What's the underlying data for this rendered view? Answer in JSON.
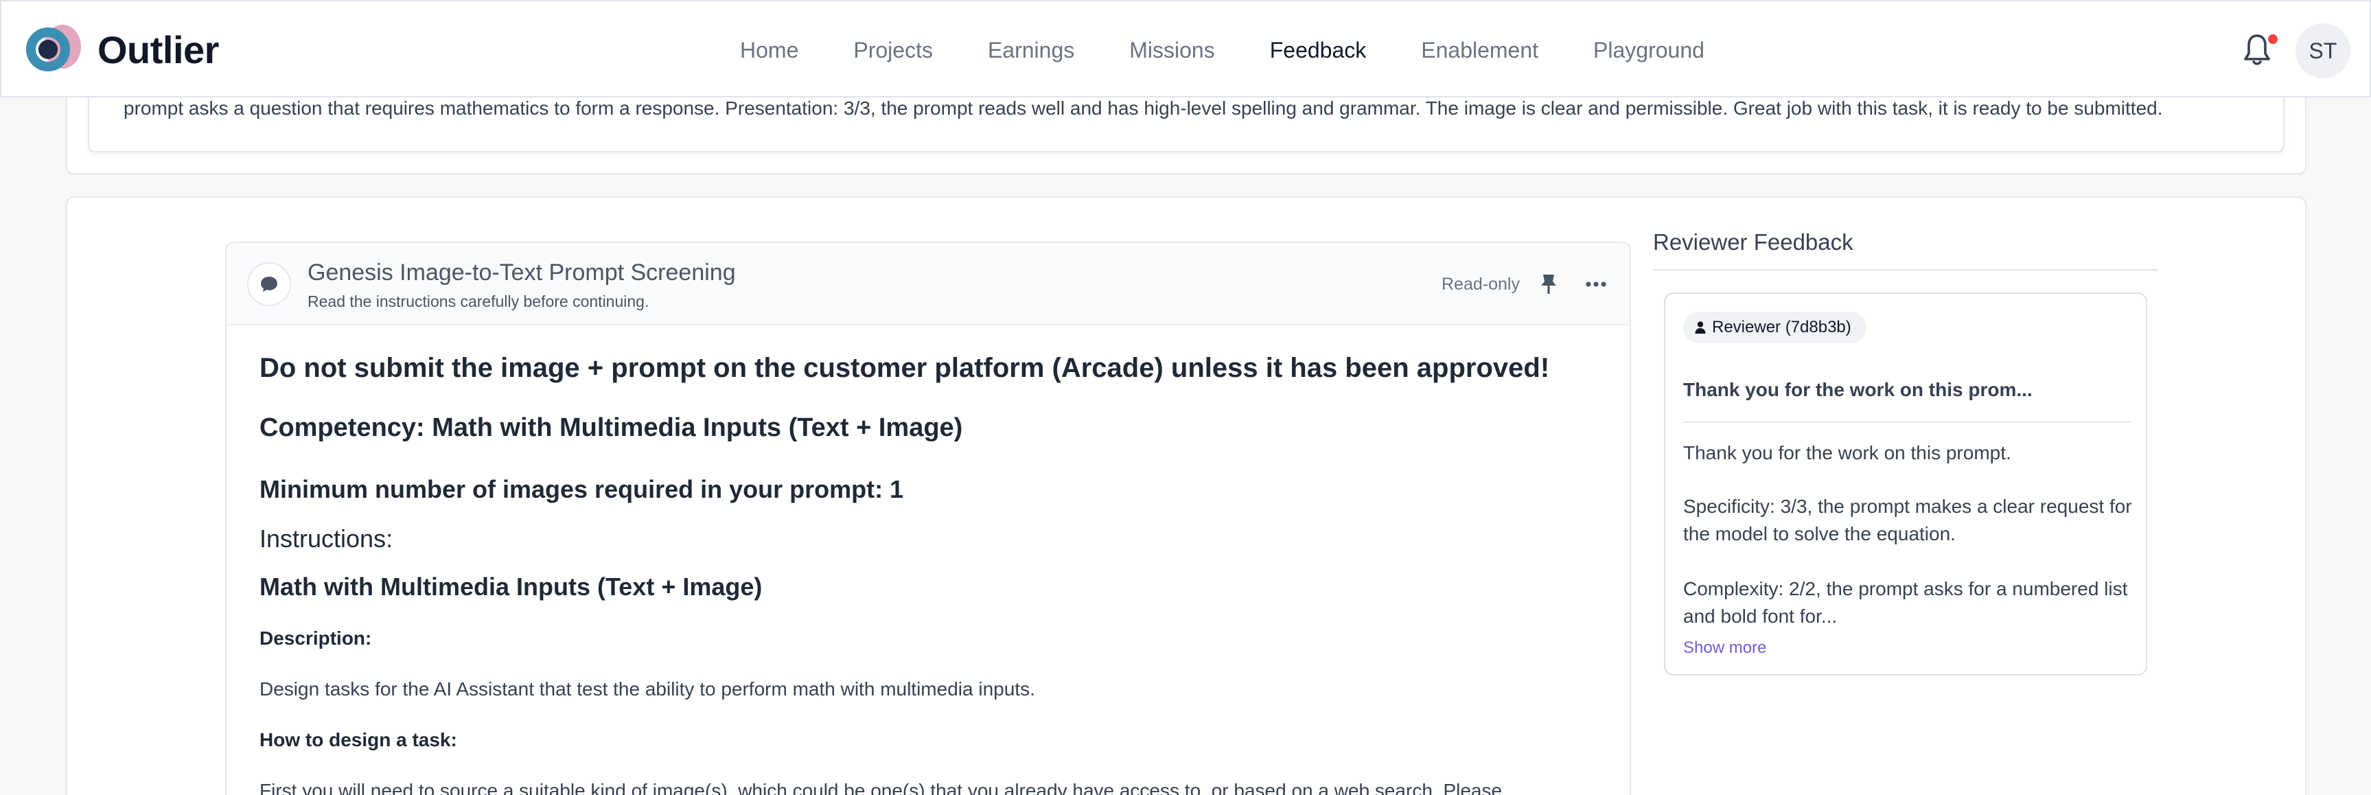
{
  "brand": {
    "name": "Outlier"
  },
  "nav": {
    "items": [
      "Home",
      "Projects",
      "Earnings",
      "Missions",
      "Feedback",
      "Enablement",
      "Playground"
    ],
    "active": "Feedback"
  },
  "user": {
    "initials": "ST"
  },
  "previous_feedback": {
    "text": "prompt asks a question that requires mathematics to form a response. Presentation: 3/3, the prompt reads well and has high-level spelling and grammar. The image is clear and permissible. Great job with this task, it is ready to be submitted."
  },
  "instructions": {
    "title": "Genesis Image-to-Text Prompt Screening",
    "subtitle": "Read the instructions carefully before continuing.",
    "status": "Read-only",
    "warning": "Do not submit the image + prompt on the customer platform (Arcade) unless it has been approved!",
    "competency": "Competency: Math with Multimedia Inputs (Text + Image)",
    "min_images": "Minimum number of images required in your prompt: 1",
    "instructions_heading": "Instructions:",
    "section_heading": "Math with Multimedia Inputs (Text + Image)",
    "description_label": "Description:",
    "description_text": "Design tasks for the AI Assistant that test the ability to perform math with multimedia inputs.",
    "how_to_label": "How to design a task:",
    "how_to_text": "First you will need to source a suitable kind of image(s), which could be one(s) that you already have access to, or based on a web search. Please"
  },
  "reviewer_feedback": {
    "heading": "Reviewer Feedback",
    "reviewer_label": "Reviewer (7d8b3b)",
    "summary": "Thank you for the work on this prom...",
    "paragraphs": [
      "Thank you for the work on this prompt.",
      "Specificity: 3/3, the prompt makes a clear request for the model to solve the equation.",
      "Complexity: 2/2, the prompt asks for a numbered list and bold font for..."
    ],
    "show_more": "Show more"
  },
  "colors": {
    "accent_link": "#6d5fd3",
    "notification_dot": "#ef4444",
    "logo_blue": "#3a8fb3",
    "logo_pink": "#d88aa8"
  }
}
